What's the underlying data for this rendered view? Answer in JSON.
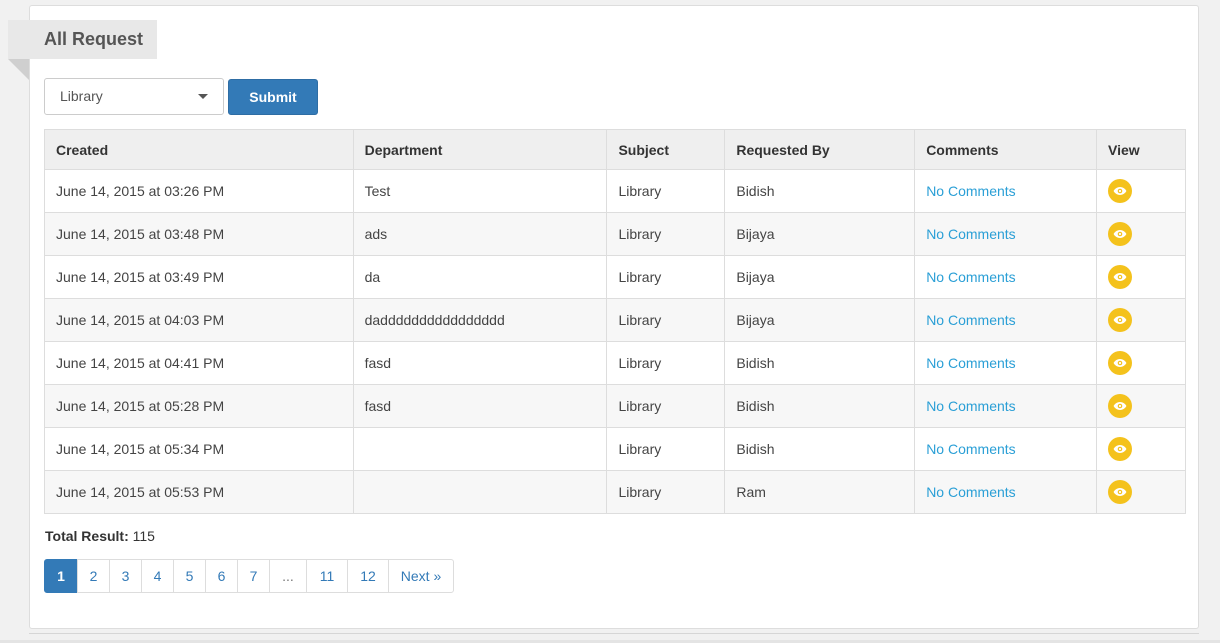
{
  "panel": {
    "title": "All Request"
  },
  "filter": {
    "selected": "Library",
    "submit_label": "Submit"
  },
  "table": {
    "headers": [
      "Created",
      "Department",
      "Subject",
      "Requested By",
      "Comments",
      "View"
    ],
    "rows": [
      {
        "created": "June 14, 2015 at 03:26 PM",
        "department": "Test",
        "subject": "Library",
        "requested_by": "Bidish",
        "comments": "No Comments"
      },
      {
        "created": "June 14, 2015 at 03:48 PM",
        "department": "ads",
        "subject": "Library",
        "requested_by": "Bijaya",
        "comments": "No Comments"
      },
      {
        "created": "June 14, 2015 at 03:49 PM",
        "department": "da",
        "subject": "Library",
        "requested_by": "Bijaya",
        "comments": "No Comments"
      },
      {
        "created": "June 14, 2015 at 04:03 PM",
        "department": "dadddddddddddddddd",
        "subject": "Library",
        "requested_by": "Bijaya",
        "comments": "No Comments"
      },
      {
        "created": "June 14, 2015 at 04:41 PM",
        "department": "fasd",
        "subject": "Library",
        "requested_by": "Bidish",
        "comments": "No Comments"
      },
      {
        "created": "June 14, 2015 at 05:28 PM",
        "department": "fasd",
        "subject": "Library",
        "requested_by": "Bidish",
        "comments": "No Comments"
      },
      {
        "created": "June 14, 2015 at 05:34 PM",
        "department": "",
        "subject": "Library",
        "requested_by": "Bidish",
        "comments": "No Comments"
      },
      {
        "created": "June 14, 2015 at 05:53 PM",
        "department": "",
        "subject": "Library",
        "requested_by": "Ram",
        "comments": "No Comments"
      }
    ],
    "view_icon": "eye-icon"
  },
  "summary": {
    "total_label": "Total Result:",
    "total_value": "115"
  },
  "pagination": {
    "pages": [
      "1",
      "2",
      "3",
      "4",
      "5",
      "6",
      "7",
      "...",
      "11",
      "12",
      "Next »"
    ],
    "active": "1"
  },
  "colors": {
    "primary": "#337ab7",
    "link": "#2a9fd6",
    "view_button": "#f4c21c"
  }
}
